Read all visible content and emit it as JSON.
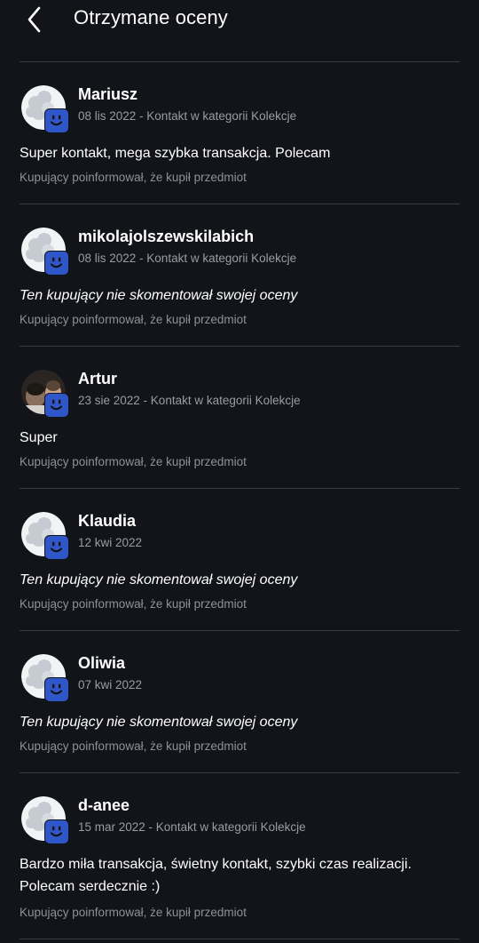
{
  "header": {
    "title": "Otrzymane oceny",
    "back_icon": "chevron-left-icon"
  },
  "colors": {
    "background": "#121419",
    "badge": "#2f57c9",
    "muted_text": "#9a9ca3"
  },
  "reviews": [
    {
      "user": "Mariusz",
      "meta": "08 lis 2022 - Kontakt w kategorii Kolekcje",
      "comment": "Super kontakt, mega szybka transakcja. Polecam",
      "buyer_note": "Kupujący poinformował, że kupił przedmiot",
      "avatar": "default"
    },
    {
      "user": "mikolajolszewskilabich",
      "meta": "08 lis 2022 - Kontakt w kategorii Kolekcje",
      "comment": "Ten kupujący nie skomentował swojej oceny",
      "buyer_note": "Kupujący poinformował, że kupił przedmiot",
      "avatar": "default"
    },
    {
      "user": "Artur",
      "meta": "23 sie 2022 - Kontakt w kategorii Kolekcje",
      "comment": "Super",
      "buyer_note": "Kupujący poinformował, że kupił przedmiot",
      "avatar": "photo"
    },
    {
      "user": "Klaudia",
      "meta": "12 kwi 2022",
      "comment": "Ten kupujący nie skomentował swojej oceny",
      "buyer_note": "Kupujący poinformował, że kupił przedmiot",
      "avatar": "default"
    },
    {
      "user": "Oliwia",
      "meta": "07 kwi 2022",
      "comment": "Ten kupujący nie skomentował swojej oceny",
      "buyer_note": "Kupujący poinformował, że kupił przedmiot",
      "avatar": "default"
    },
    {
      "user": "d-anee",
      "meta": "15 mar 2022 - Kontakt w kategorii Kolekcje",
      "comment": "Bardzo miła transakcja, świetny kontakt, szybki czas realizacji. Polecam serdecznie :)",
      "buyer_note": "Kupujący poinformował, że kupił przedmiot",
      "avatar": "default"
    }
  ]
}
